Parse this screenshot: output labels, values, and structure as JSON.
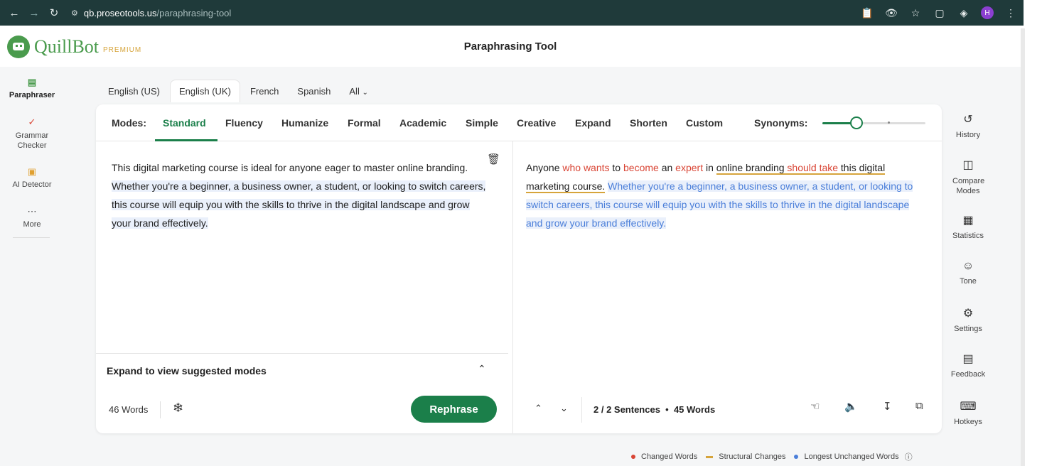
{
  "browser": {
    "url_domain": "qb.proseotools.us",
    "url_path": "/paraphrasing-tool",
    "profile_initial": "H"
  },
  "header": {
    "logo_text": "QuillBot",
    "premium_label": "PREMIUM",
    "title": "Paraphrasing Tool"
  },
  "left_sidebar": {
    "items": [
      {
        "label": "Paraphraser",
        "icon": "document-icon"
      },
      {
        "label": "Grammar Checker",
        "icon": "grammar-icon"
      },
      {
        "label": "AI Detector",
        "icon": "ai-detector-icon"
      },
      {
        "label": "More",
        "icon": "ellipsis-icon"
      }
    ]
  },
  "languages": {
    "tabs": [
      "English (US)",
      "English (UK)",
      "French",
      "Spanish",
      "All"
    ],
    "active": "English (UK)"
  },
  "modes": {
    "label": "Modes:",
    "items": [
      "Standard",
      "Fluency",
      "Humanize",
      "Formal",
      "Academic",
      "Simple",
      "Creative",
      "Expand",
      "Shorten",
      "Custom"
    ],
    "active": "Standard",
    "synonyms_label": "Synonyms:",
    "synonyms_level": 0.33
  },
  "input": {
    "first_sentence": "This digital marketing course is ideal for anyone eager to master online branding.",
    "second_sentence": "Whether you're a beginner, a business owner, a student, or looking to switch careers, this course will equip you with the skills to thrive in the digital landscape and grow your brand effectively.",
    "expand_label": "Expand to view suggested modes",
    "word_count": "46 Words",
    "rephrase_label": "Rephrase"
  },
  "output": {
    "segments": {
      "s1": "Anyone ",
      "s2": "who wants",
      "s3": " to ",
      "s4": "become",
      "s5": " an ",
      "s6": "expert",
      "s7": " in ",
      "s8": "online branding",
      "s9": " ",
      "s10": "should take",
      "s11": " this digital marketing course."
    },
    "unchanged": "Whether you're a beginner, a business owner, a student, or looking to switch careers, this course will equip you with the skills to thrive in the digital landscape and grow your brand effectively.",
    "sentence_info": "2 / 2 Sentences",
    "word_count": "45 Words"
  },
  "right_sidebar": {
    "items": [
      {
        "label": "History",
        "icon": "history-icon"
      },
      {
        "label": "Compare Modes",
        "icon": "compare-icon"
      },
      {
        "label": "Statistics",
        "icon": "statistics-icon"
      },
      {
        "label": "Tone",
        "icon": "smiley-icon"
      },
      {
        "label": "Settings",
        "icon": "gear-icon"
      },
      {
        "label": "Feedback",
        "icon": "feedback-icon"
      },
      {
        "label": "Hotkeys",
        "icon": "keyboard-icon"
      }
    ]
  },
  "legend": {
    "changed": "Changed Words",
    "structural": "Structural Changes",
    "unchanged": "Longest Unchanged Words"
  },
  "colors": {
    "brand_green": "#1b7f4a",
    "changed_red": "#d94535",
    "structural_yellow": "#d6a43b",
    "unchanged_blue": "#4a7ed9"
  }
}
